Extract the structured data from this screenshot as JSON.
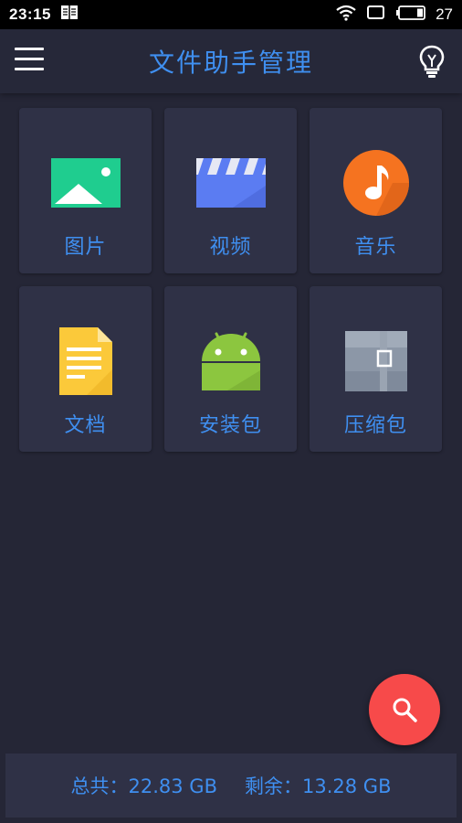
{
  "status_bar": {
    "time": "23:15",
    "battery_level": "27",
    "icons": [
      "book-icon",
      "wifi-icon",
      "screen-icon",
      "battery-icon"
    ]
  },
  "app_bar": {
    "title": "文件助手管理",
    "left_icon": "menu-icon",
    "right_icon": "lightbulb-icon"
  },
  "categories": [
    {
      "label": "图片",
      "icon": "image-icon",
      "color": "#1fcd8f"
    },
    {
      "label": "视频",
      "icon": "clapperboard-icon",
      "color": "#5b7cf2"
    },
    {
      "label": "音乐",
      "icon": "music-note-icon",
      "color": "#f57320"
    },
    {
      "label": "文档",
      "icon": "document-icon",
      "color": "#fbc93a"
    },
    {
      "label": "安装包",
      "icon": "android-icon",
      "color": "#8cc63f"
    },
    {
      "label": "压缩包",
      "icon": "archive-icon",
      "color": "#8c97a7"
    }
  ],
  "fab": {
    "icon": "search-icon",
    "color": "#f74a4a"
  },
  "storage": {
    "total_label": "总共：",
    "total_value": "22.83 GB",
    "free_label": "剩余：",
    "free_value": "13.28 GB"
  },
  "colors": {
    "accent": "#3f8ff0",
    "background": "#252636",
    "tile": "#2f3146"
  }
}
